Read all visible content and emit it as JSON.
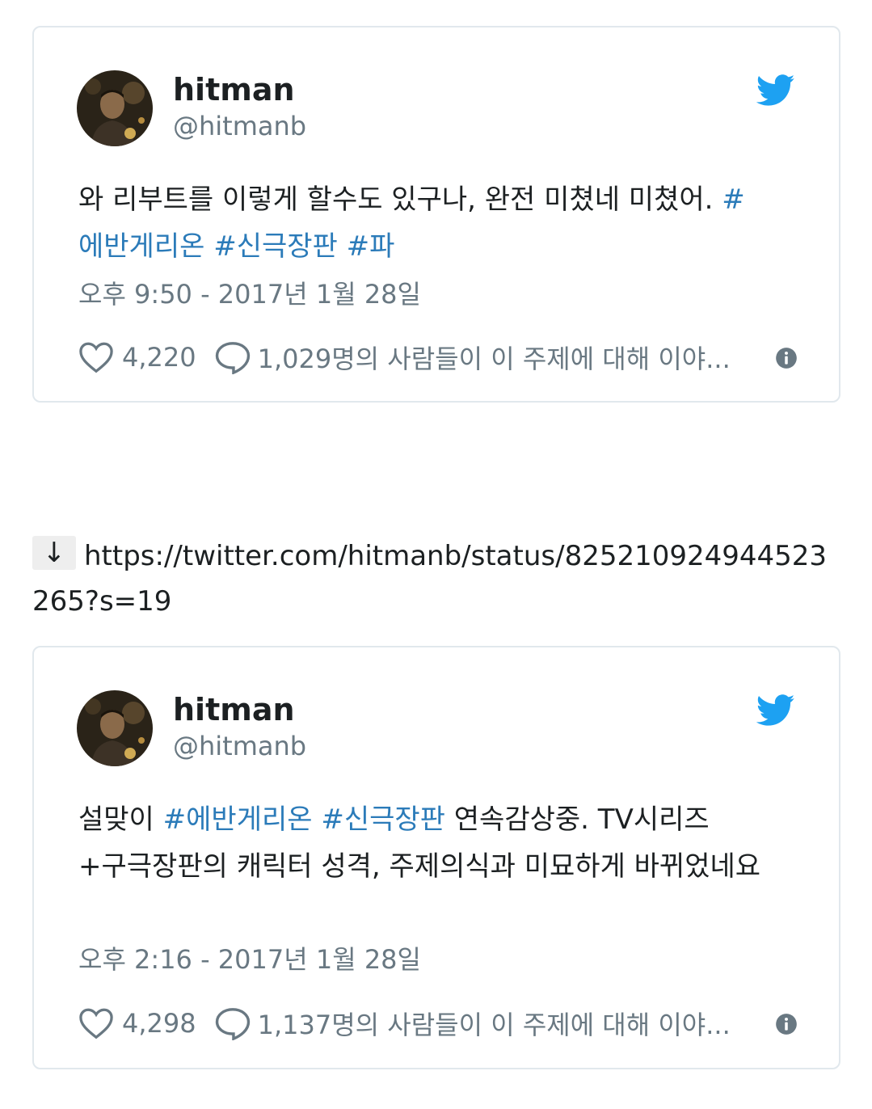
{
  "tweets": [
    {
      "display_name": "hitman",
      "handle": "@hitmanb",
      "text_plain": "와 리부트를 이렇게 할수도 있구나, 완전 미쳤네 미쳤어.",
      "hashtags": [
        "#에반게리온",
        "#신극장판",
        "#파"
      ],
      "timestamp": "오후 9:50 - 2017년 1월 28일",
      "likes": "4,220",
      "replies_text": "1,029명의 사람들이 이 주제에 대해 이야..."
    },
    {
      "display_name": "hitman",
      "handle": "@hitmanb",
      "text_prefix": "설맞이",
      "hashtags": [
        "#에반게리온",
        "#신극장판"
      ],
      "text_suffix": "연속감상중. TV시리즈+구극장판의 캐릭터 성격, 주제의식과 미묘하게 바뀌었네요",
      "timestamp": "오후 2:16 - 2017년 1월 28일",
      "likes": "4,298",
      "replies_text": "1,137명의 사람들이 이 주제에 대해 이야..."
    }
  ],
  "link": {
    "arrow": "↓",
    "url": "https://twitter.com/hitmanb/status/825210924944523265?s=19"
  },
  "icons": {
    "brand": "twitter-bird-icon",
    "like": "heart-icon",
    "reply": "reply-bubble-icon",
    "info": "info-icon"
  },
  "colors": {
    "brand": "#1da1f2",
    "hashtag": "#2b7bb9",
    "secondary_text": "#697882",
    "border": "#e1e8ed"
  }
}
